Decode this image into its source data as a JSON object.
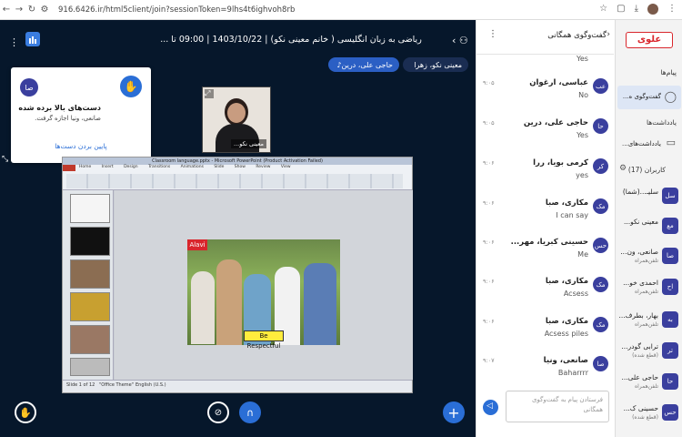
{
  "browser": {
    "url": "916.6426.ir/html5client/join?sessionToken=9lhs4t6ighvoh8rb"
  },
  "topbar": {
    "title": "ریاضی به زبان انگلیسی ( خانم معینی نکو) | 1403/10/22 | 09:00 تا ...",
    "presenters": [
      "معینی نکو، زهرا",
      "حاجی علی، درین"
    ]
  },
  "notification": {
    "title": "دست‌های بالا برده شده",
    "subtitle": "صانعی، ونیا اجازه گرفت.",
    "action": "پایین بردن دست‌ها",
    "avatar": "صا"
  },
  "webcam": {
    "name": "معینی نکو..."
  },
  "slide": {
    "window_title": "Classroom language.pptx - Microsoft PowerPoint (Product Activation Failed)",
    "logo": "Alavi",
    "banner": "Be Respectful",
    "menu_tabs": [
      "File",
      "Home",
      "Insert",
      "Design",
      "Transitions",
      "Animations",
      "Slide Show",
      "Review",
      "View"
    ],
    "status_left": "Slide 1 of 12",
    "status_mid": "\"Office Theme\"",
    "status_lang": "English (U.S.)"
  },
  "chat": {
    "header": "گفت‌وگوی همگانی",
    "first_text": "Yes",
    "messages": [
      {
        "avatar": "عب",
        "name": "عباسی، ارغوان",
        "time": "۹:۰۵",
        "text": "No"
      },
      {
        "avatar": "حا",
        "name": "حاجی علی، درین",
        "time": "۹:۰۵",
        "text": "Yes"
      },
      {
        "avatar": "کر",
        "name": "کرمی بویا، ررا",
        "time": "۹:۰۶",
        "text": "yes"
      },
      {
        "avatar": "مک",
        "name": "مکاری، صبا",
        "time": "۹:۰۶",
        "text": "I can say"
      },
      {
        "avatar": "حس",
        "name": "حسینی کبریا، مهر...",
        "time": "۹:۰۶",
        "text": "Me"
      },
      {
        "avatar": "مک",
        "name": "مکاری، صبا",
        "time": "۹:۰۶",
        "text": "Acsess"
      },
      {
        "avatar": "مک",
        "name": "مکاری، صبا",
        "time": "۹:۰۶",
        "text": "Acsess piles"
      },
      {
        "avatar": "صا",
        "name": "صانعی، ونیا",
        "time": "۹:۰۷",
        "text": "Baharrrr"
      }
    ],
    "input_placeholder": "فرستادن پیام به گفت‌وگوی همگانی"
  },
  "sidebar": {
    "brand": "علوی",
    "messages_title": "پیام‌ها",
    "public_chat": "گفت‌وگوی ه...",
    "notes_title": "یادداشت‌ها",
    "shared_notes": "یادداشت‌های...",
    "users_title": "کاربران (17)",
    "users": [
      {
        "avatar": "سل",
        "name": "سلیـ...(شما)",
        "sub": ""
      },
      {
        "avatar": "مع",
        "name": "معینی نکو...",
        "sub": ""
      },
      {
        "avatar": "صا",
        "name": "صانعی، ون...",
        "sub": "تلفن‌همراه"
      },
      {
        "avatar": "اح",
        "name": "احمدی خو...",
        "sub": "تلفن‌همراه"
      },
      {
        "avatar": "به",
        "name": "بهار، بطرف...",
        "sub": "تلفن‌همراه"
      },
      {
        "avatar": "تر",
        "name": "ترابی گودر...",
        "sub": "(قطع شده)"
      },
      {
        "avatar": "حا",
        "name": "حاجی علی...",
        "sub": "تلفن‌همراه"
      },
      {
        "avatar": "حس",
        "name": "حسینی ک...",
        "sub": "(قطع شده)"
      }
    ]
  },
  "colors": {
    "main_bg": "#06172b",
    "accent": "#2a6ed6",
    "avatar": "#3a3f9e",
    "brand_red": "#d9262c"
  }
}
